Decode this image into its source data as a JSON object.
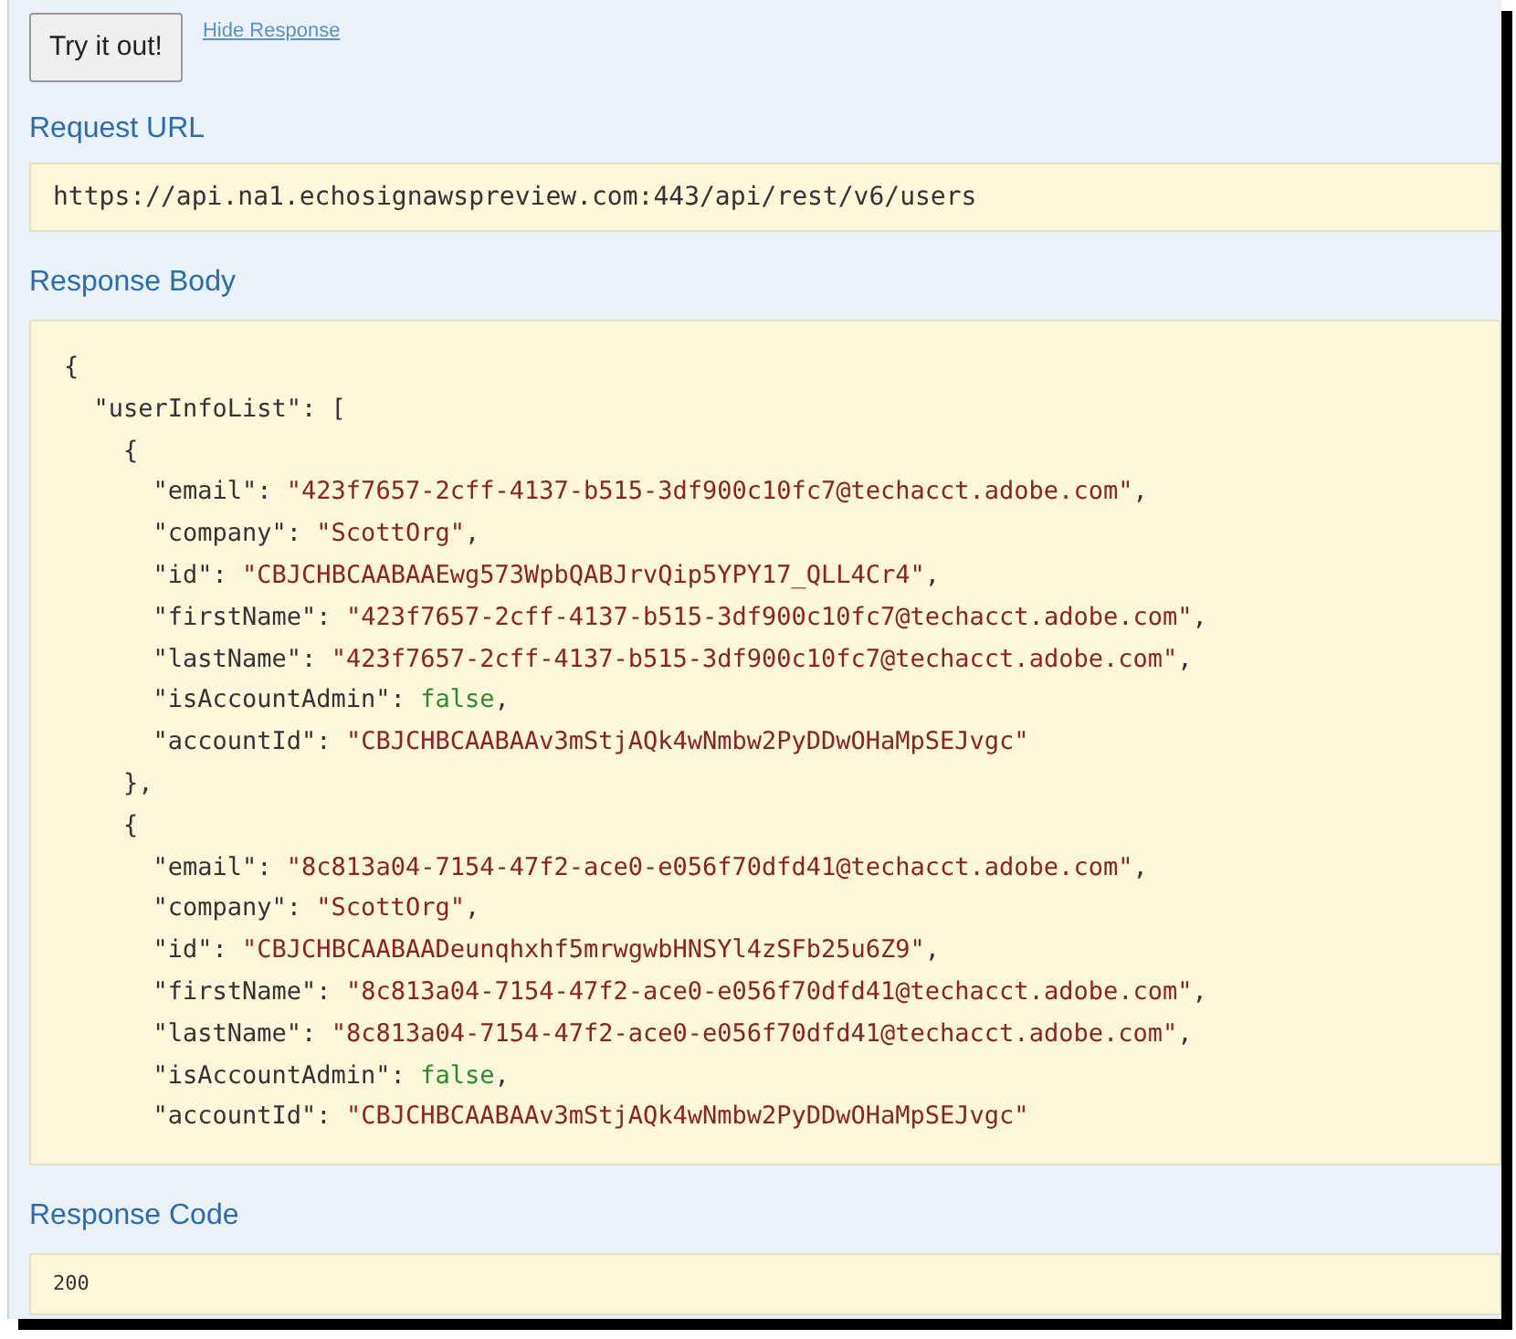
{
  "try_button": {
    "label": "Try it out!"
  },
  "hide_link": {
    "label": "Hide Response"
  },
  "request_url": {
    "heading": "Request URL",
    "value": "https://api.na1.echosignawspreview.com:443/api/rest/v6/users"
  },
  "response_body": {
    "heading": "Response Body",
    "lines": [
      [
        {
          "kind": "punct",
          "text": "{"
        }
      ],
      [
        {
          "kind": "key",
          "text": "  \"userInfoList\": ["
        }
      ],
      [
        {
          "kind": "punct",
          "text": "    {"
        }
      ],
      [
        {
          "kind": "key",
          "text": "      \"email\": "
        },
        {
          "kind": "string",
          "text": "\"423f7657-2cff-4137-b515-3df900c10fc7@techacct.adobe.com\""
        },
        {
          "kind": "punct",
          "text": ","
        }
      ],
      [
        {
          "kind": "key",
          "text": "      \"company\": "
        },
        {
          "kind": "string",
          "text": "\"ScottOrg\""
        },
        {
          "kind": "punct",
          "text": ","
        }
      ],
      [
        {
          "kind": "key",
          "text": "      \"id\": "
        },
        {
          "kind": "string",
          "text": "\"CBJCHBCAABAAEwg573WpbQABJrvQip5YPY17_QLL4Cr4\""
        },
        {
          "kind": "punct",
          "text": ","
        }
      ],
      [
        {
          "kind": "key",
          "text": "      \"firstName\": "
        },
        {
          "kind": "string",
          "text": "\"423f7657-2cff-4137-b515-3df900c10fc7@techacct.adobe.com\""
        },
        {
          "kind": "punct",
          "text": ","
        }
      ],
      [
        {
          "kind": "key",
          "text": "      \"lastName\": "
        },
        {
          "kind": "string",
          "text": "\"423f7657-2cff-4137-b515-3df900c10fc7@techacct.adobe.com\""
        },
        {
          "kind": "punct",
          "text": ","
        }
      ],
      [
        {
          "kind": "key",
          "text": "      \"isAccountAdmin\": "
        },
        {
          "kind": "boolean",
          "text": "false"
        },
        {
          "kind": "punct",
          "text": ","
        }
      ],
      [
        {
          "kind": "key",
          "text": "      \"accountId\": "
        },
        {
          "kind": "string",
          "text": "\"CBJCHBCAABAAv3mStjAQk4wNmbw2PyDDwOHaMpSEJvgc\""
        }
      ],
      [
        {
          "kind": "punct",
          "text": "    },"
        }
      ],
      [
        {
          "kind": "punct",
          "text": "    {"
        }
      ],
      [
        {
          "kind": "key",
          "text": "      \"email\": "
        },
        {
          "kind": "string",
          "text": "\"8c813a04-7154-47f2-ace0-e056f70dfd41@techacct.adobe.com\""
        },
        {
          "kind": "punct",
          "text": ","
        }
      ],
      [
        {
          "kind": "key",
          "text": "      \"company\": "
        },
        {
          "kind": "string",
          "text": "\"ScottOrg\""
        },
        {
          "kind": "punct",
          "text": ","
        }
      ],
      [
        {
          "kind": "key",
          "text": "      \"id\": "
        },
        {
          "kind": "string",
          "text": "\"CBJCHBCAABAADeunqhxhf5mrwgwbHNSYl4zSFb25u6Z9\""
        },
        {
          "kind": "punct",
          "text": ","
        }
      ],
      [
        {
          "kind": "key",
          "text": "      \"firstName\": "
        },
        {
          "kind": "string",
          "text": "\"8c813a04-7154-47f2-ace0-e056f70dfd41@techacct.adobe.com\""
        },
        {
          "kind": "punct",
          "text": ","
        }
      ],
      [
        {
          "kind": "key",
          "text": "      \"lastName\": "
        },
        {
          "kind": "string",
          "text": "\"8c813a04-7154-47f2-ace0-e056f70dfd41@techacct.adobe.com\""
        },
        {
          "kind": "punct",
          "text": ","
        }
      ],
      [
        {
          "kind": "key",
          "text": "      \"isAccountAdmin\": "
        },
        {
          "kind": "boolean",
          "text": "false"
        },
        {
          "kind": "punct",
          "text": ","
        }
      ],
      [
        {
          "kind": "key",
          "text": "      \"accountId\": "
        },
        {
          "kind": "string",
          "text": "\"CBJCHBCAABAAv3mStjAQk4wNmbw2PyDDwOHaMpSEJvgc\""
        }
      ]
    ]
  },
  "response_code": {
    "heading": "Response Code",
    "value": "200"
  }
}
